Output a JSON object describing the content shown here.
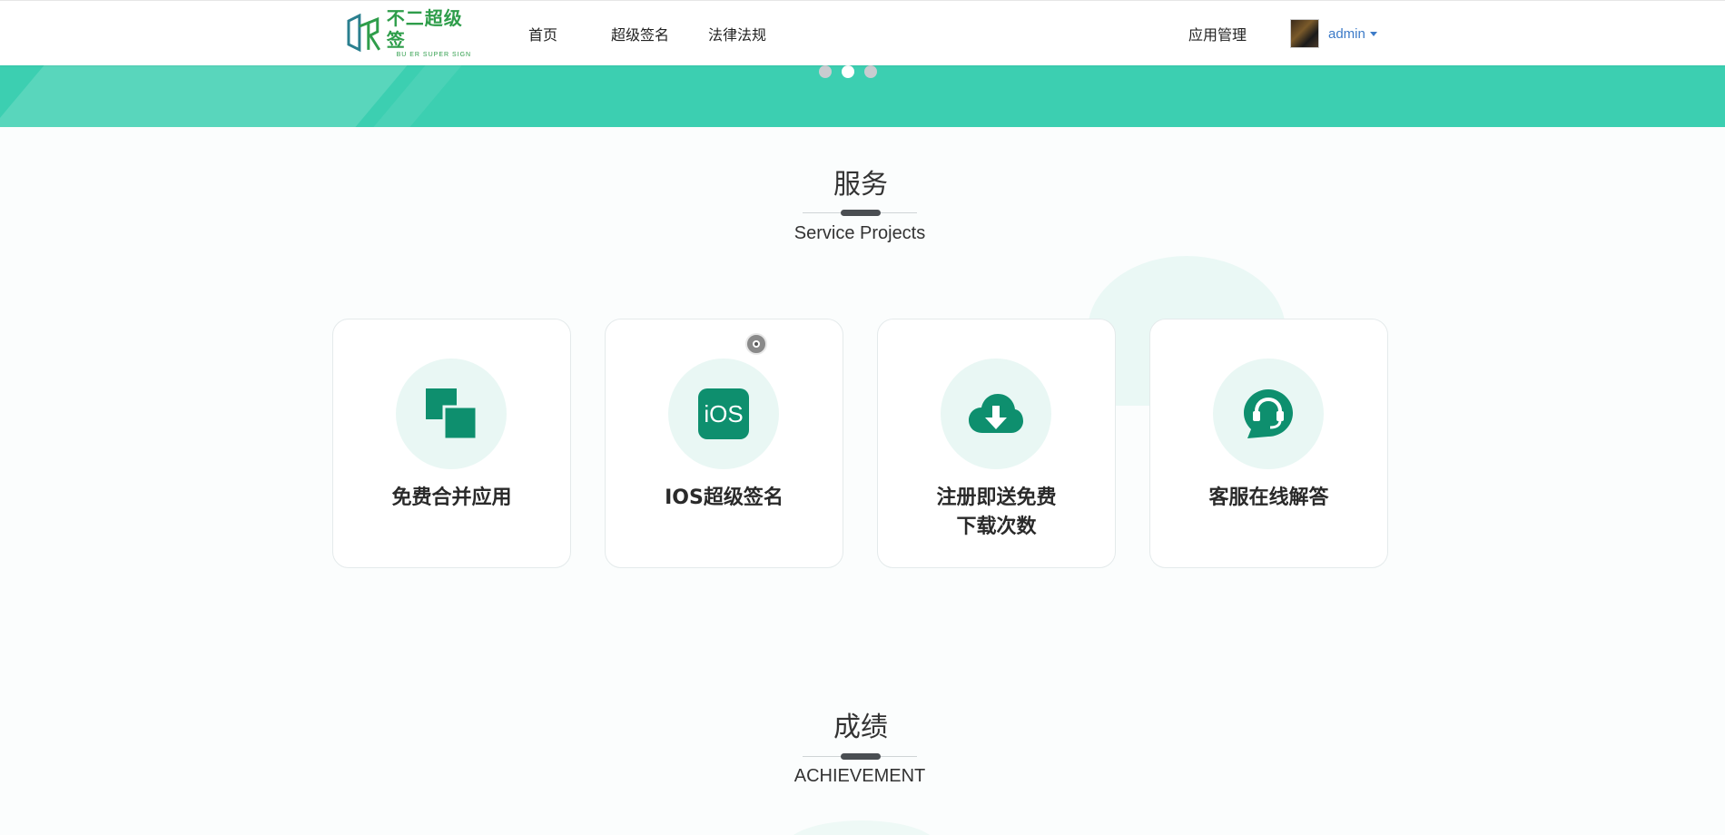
{
  "header": {
    "logo_title": "不二超级签",
    "logo_sub": "BU ER SUPER SIGN",
    "nav": [
      {
        "label": "首页"
      },
      {
        "label": "超级签名"
      },
      {
        "label": "法律法规"
      }
    ],
    "apps_label": "应用管理",
    "username": "admin"
  },
  "banner": {
    "slide_count": 3,
    "active_slide": 2
  },
  "services": {
    "title": "服务",
    "subtitle": "Service Projects",
    "cards": [
      {
        "icon": "merge-apps-icon",
        "label": "免费合并应用"
      },
      {
        "icon": "ios-icon",
        "label": "IOS超级签名",
        "icon_text": "iOS"
      },
      {
        "icon": "cloud-download-icon",
        "label_line1": "注册即送免费",
        "label_line2": "下载次数"
      },
      {
        "icon": "customer-service-icon",
        "label": "客服在线解答"
      }
    ]
  },
  "achievement": {
    "title": "成绩",
    "subtitle": "ACHIEVEMENT"
  },
  "colors": {
    "brand": "#2e9d4a",
    "banner": "#3ccfb1",
    "icon_green": "#0e8f6e",
    "icon_bg": "#e9f7f4",
    "link": "#3d7bc8"
  }
}
